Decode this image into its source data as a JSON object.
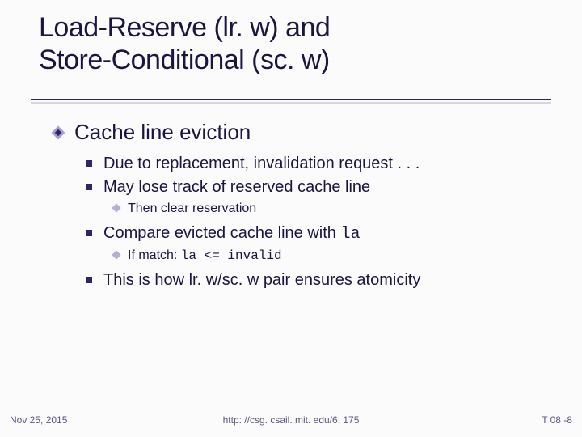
{
  "title": {
    "line1": "Load-Reserve (lr. w) and",
    "line2": "Store-Conditional (sc. w)"
  },
  "body": {
    "l1_1": "Cache line eviction",
    "l2_1": "Due to replacement, invalidation request . . .",
    "l2_2": "May lose track of reserved cache line",
    "l3_1": "Then clear reservation",
    "l2_3_pre": "Compare evicted cache line with ",
    "l2_3_mono": "la",
    "l3_2_pre": "If match: ",
    "l3_2_mono": "la <= invalid",
    "l2_4": "This is how lr. w/sc. w pair ensures atomicity"
  },
  "footer": {
    "date": "Nov 25, 2015",
    "url": "http: //csg. csail. mit. edu/6. 175",
    "page": "T 08 -8"
  }
}
